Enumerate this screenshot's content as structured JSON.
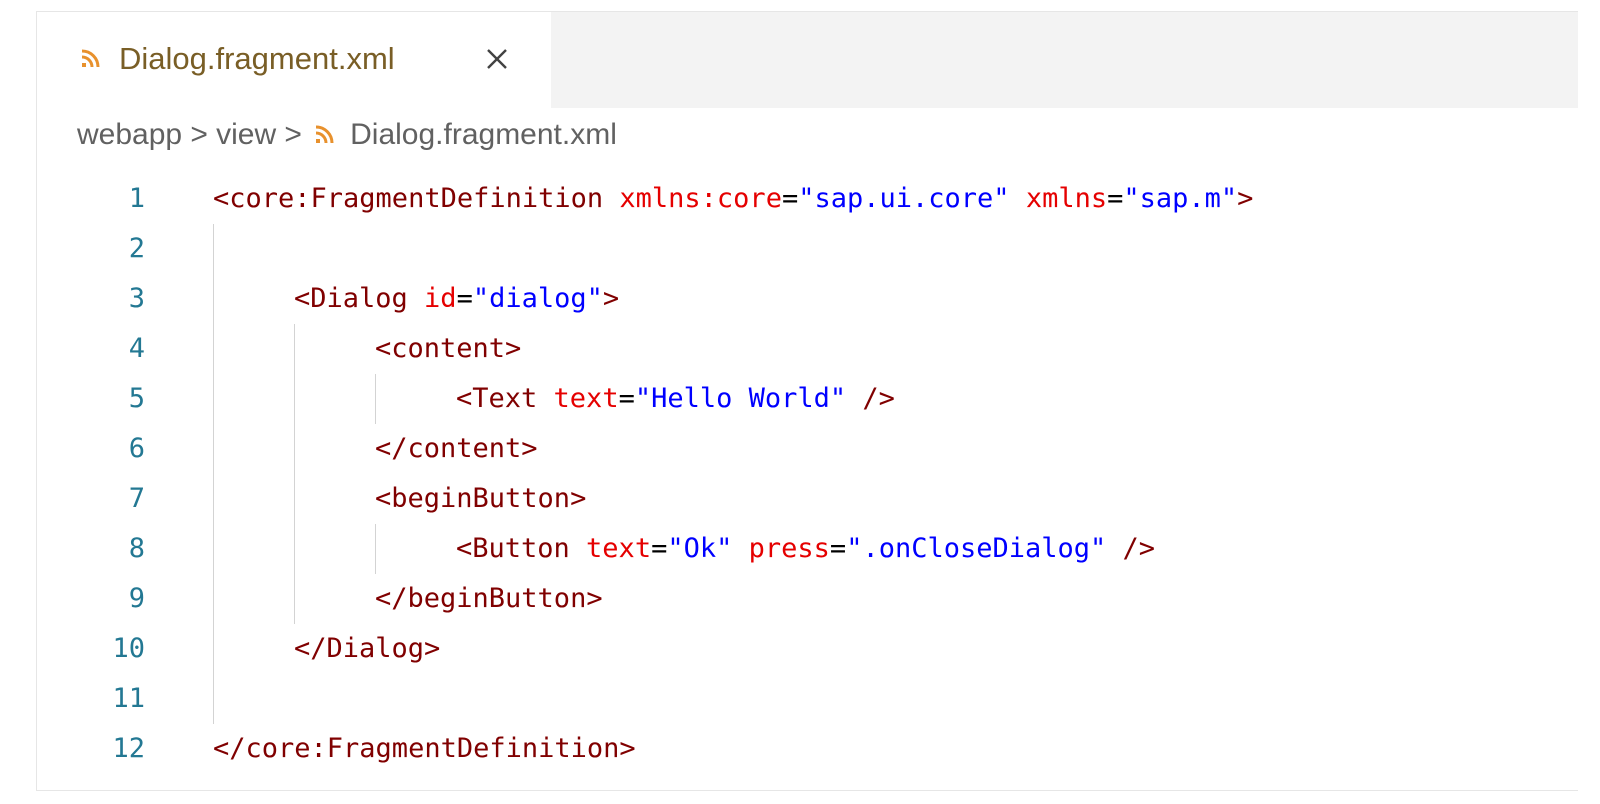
{
  "tab": {
    "title": "Dialog.fragment.xml",
    "icon": "rss-icon",
    "close_icon": "close-icon"
  },
  "breadcrumb": {
    "items": [
      "webapp",
      "view",
      "Dialog.fragment.xml"
    ],
    "separator": ">"
  },
  "colors": {
    "tag": "#800000",
    "attribute": "#e50000",
    "string": "#0000ff",
    "line_number": "#237893",
    "tab_title": "#795e26",
    "rss_icon": "#e8912d"
  },
  "lines": [
    {
      "n": "1",
      "indent": 0,
      "tokens": [
        {
          "t": "tag",
          "v": "<core:FragmentDefinition "
        },
        {
          "t": "attr",
          "v": "xmlns:core"
        },
        {
          "t": "eq",
          "v": "="
        },
        {
          "t": "str",
          "v": "\"sap.ui.core\""
        },
        {
          "t": "eq",
          "v": " "
        },
        {
          "t": "attr",
          "v": "xmlns"
        },
        {
          "t": "eq",
          "v": "="
        },
        {
          "t": "str",
          "v": "\"sap.m\""
        },
        {
          "t": "tag",
          "v": ">"
        }
      ]
    },
    {
      "n": "2",
      "indent": 0,
      "tokens": []
    },
    {
      "n": "3",
      "indent": 1,
      "tokens": [
        {
          "t": "tag",
          "v": "<Dialog "
        },
        {
          "t": "attr",
          "v": "id"
        },
        {
          "t": "eq",
          "v": "="
        },
        {
          "t": "str",
          "v": "\"dialog\""
        },
        {
          "t": "tag",
          "v": ">"
        }
      ]
    },
    {
      "n": "4",
      "indent": 2,
      "tokens": [
        {
          "t": "tag",
          "v": "<content>"
        }
      ]
    },
    {
      "n": "5",
      "indent": 3,
      "tokens": [
        {
          "t": "tag",
          "v": "<Text "
        },
        {
          "t": "attr",
          "v": "text"
        },
        {
          "t": "eq",
          "v": "="
        },
        {
          "t": "str",
          "v": "\"Hello World\""
        },
        {
          "t": "tag",
          "v": " />"
        }
      ]
    },
    {
      "n": "6",
      "indent": 2,
      "tokens": [
        {
          "t": "tag",
          "v": "</content>"
        }
      ]
    },
    {
      "n": "7",
      "indent": 2,
      "tokens": [
        {
          "t": "tag",
          "v": "<beginButton>"
        }
      ]
    },
    {
      "n": "8",
      "indent": 3,
      "tokens": [
        {
          "t": "tag",
          "v": "<Button "
        },
        {
          "t": "attr",
          "v": "text"
        },
        {
          "t": "eq",
          "v": "="
        },
        {
          "t": "str",
          "v": "\"Ok\""
        },
        {
          "t": "eq",
          "v": " "
        },
        {
          "t": "attr",
          "v": "press"
        },
        {
          "t": "eq",
          "v": "="
        },
        {
          "t": "str",
          "v": "\".onCloseDialog\""
        },
        {
          "t": "tag",
          "v": " />"
        }
      ]
    },
    {
      "n": "9",
      "indent": 2,
      "tokens": [
        {
          "t": "tag",
          "v": "</beginButton>"
        }
      ]
    },
    {
      "n": "10",
      "indent": 1,
      "tokens": [
        {
          "t": "tag",
          "v": "</Dialog>"
        }
      ]
    },
    {
      "n": "11",
      "indent": 0,
      "tokens": []
    },
    {
      "n": "12",
      "indent": 0,
      "tokens": [
        {
          "t": "tag",
          "v": "</core:FragmentDefinition>"
        }
      ]
    }
  ]
}
